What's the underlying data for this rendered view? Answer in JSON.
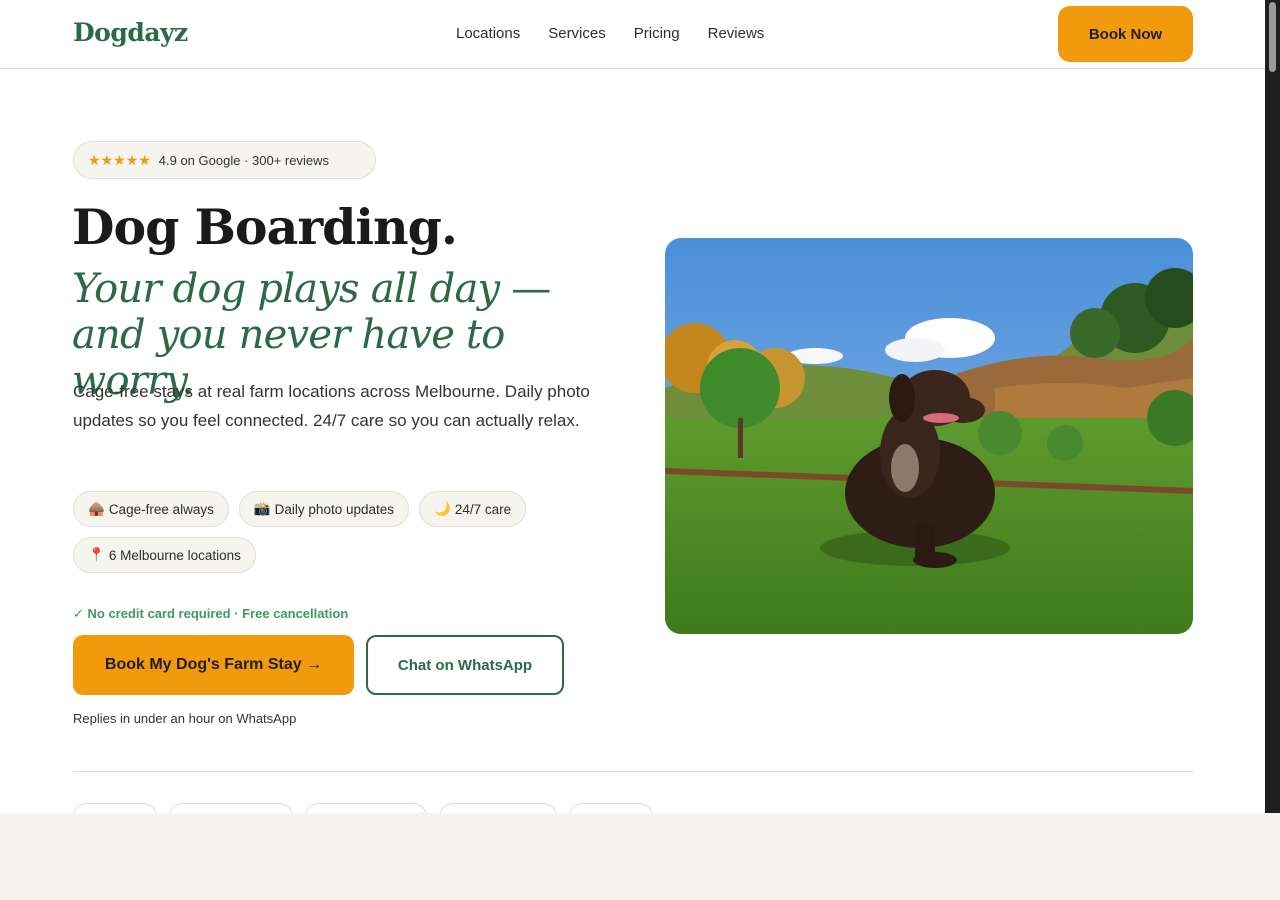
{
  "header": {
    "logo": "Dogdayz",
    "nav": [
      "Locations",
      "Services",
      "Pricing",
      "Reviews"
    ],
    "book_now": "Book Now"
  },
  "hero": {
    "rating": {
      "stars": "★★★★★",
      "text": "4.9 on Google · 300+ reviews"
    },
    "title": "Dog Boarding.",
    "subtitle": "Your dog plays all day — and you never have to worry.",
    "description": "Cage-free stays at real farm locations across Melbourne. Daily photo updates so you feel connected. 24/7 care so you can actually relax.",
    "features": [
      {
        "icon": "🛖",
        "label": "Cage-free always"
      },
      {
        "icon": "📸",
        "label": "Daily photo updates"
      },
      {
        "icon": "🌙",
        "label": "24/7 care"
      },
      {
        "icon": "📍",
        "label": "6 Melbourne locations"
      }
    ],
    "assurance": "✓ No credit card required · Free cancellation",
    "cta_primary": "Book My Dog's Farm Stay →",
    "cta_secondary": "Chat on WhatsApp",
    "reply_note": "Replies in under an hour on WhatsApp"
  },
  "colors": {
    "brand_green": "#2a6a45",
    "accent_orange": "#f29a0e",
    "assurance_green": "#3f9a5d",
    "pill_bg": "#f5f4ef"
  }
}
